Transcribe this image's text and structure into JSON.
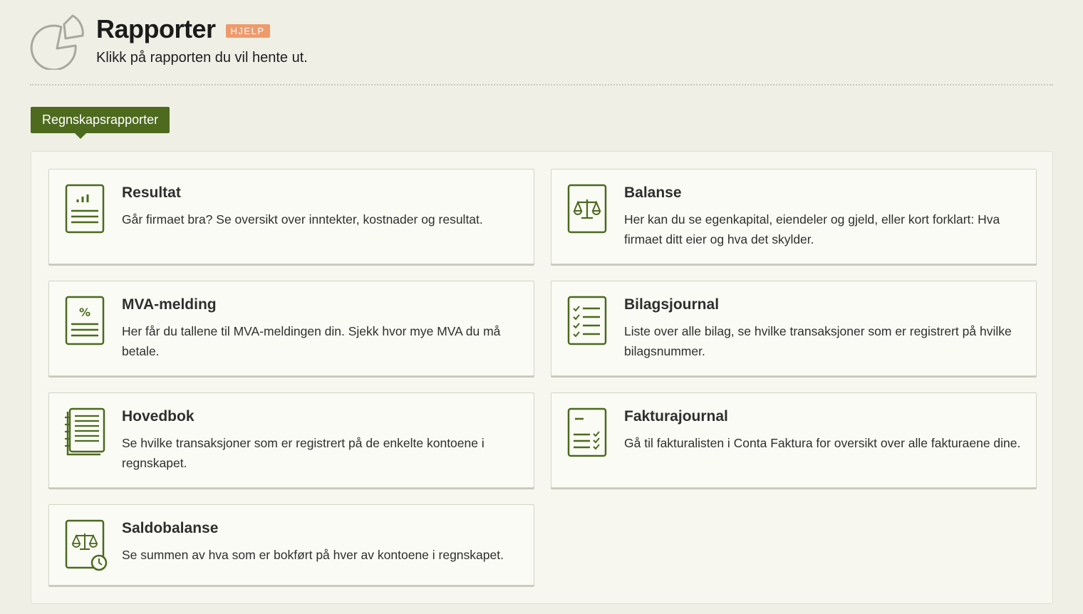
{
  "header": {
    "title": "Rapporter",
    "help_label": "HJELP",
    "subtitle": "Klikk på rapporten du vil hente ut."
  },
  "tabs": [
    {
      "label": "Regnskapsrapporter",
      "active": true
    }
  ],
  "reports": [
    {
      "title": "Resultat",
      "description": "Går firmaet bra? Se oversikt over inntekter, kostnader og resultat.",
      "icon": "bar-chart-document-icon"
    },
    {
      "title": "Balanse",
      "description": "Her kan du se egenkapital, eiendeler og gjeld, eller kort forklart: Hva firmaet ditt eier og hva det skylder.",
      "icon": "scales-document-icon"
    },
    {
      "title": "MVA-melding",
      "description": "Her får du tallene til MVA-meldingen din. Sjekk hvor mye MVA du må betale.",
      "icon": "percent-document-icon"
    },
    {
      "title": "Bilagsjournal",
      "description": "Liste over alle bilag, se hvilke transaksjoner som er registrert på hvilke bilagsnummer.",
      "icon": "checklist-document-icon"
    },
    {
      "title": "Hovedbok",
      "description": "Se hvilke transaksjoner som er registrert på de enkelte kontoene i regnskapet.",
      "icon": "ledger-book-icon"
    },
    {
      "title": "Fakturajournal",
      "description": "Gå til fakturalisten i Conta Faktura for oversikt over alle fakturaene dine.",
      "icon": "invoice-checklist-icon"
    },
    {
      "title": "Saldobalanse",
      "description": "Se summen av hva som er bokført på hver av kontoene i regnskapet.",
      "icon": "scales-clock-document-icon"
    }
  ],
  "colors": {
    "accent": "#4e6a1f",
    "icon_stroke": "#4a6a1e",
    "help_badge": "#ef9a6b",
    "background": "#f0efe6"
  }
}
